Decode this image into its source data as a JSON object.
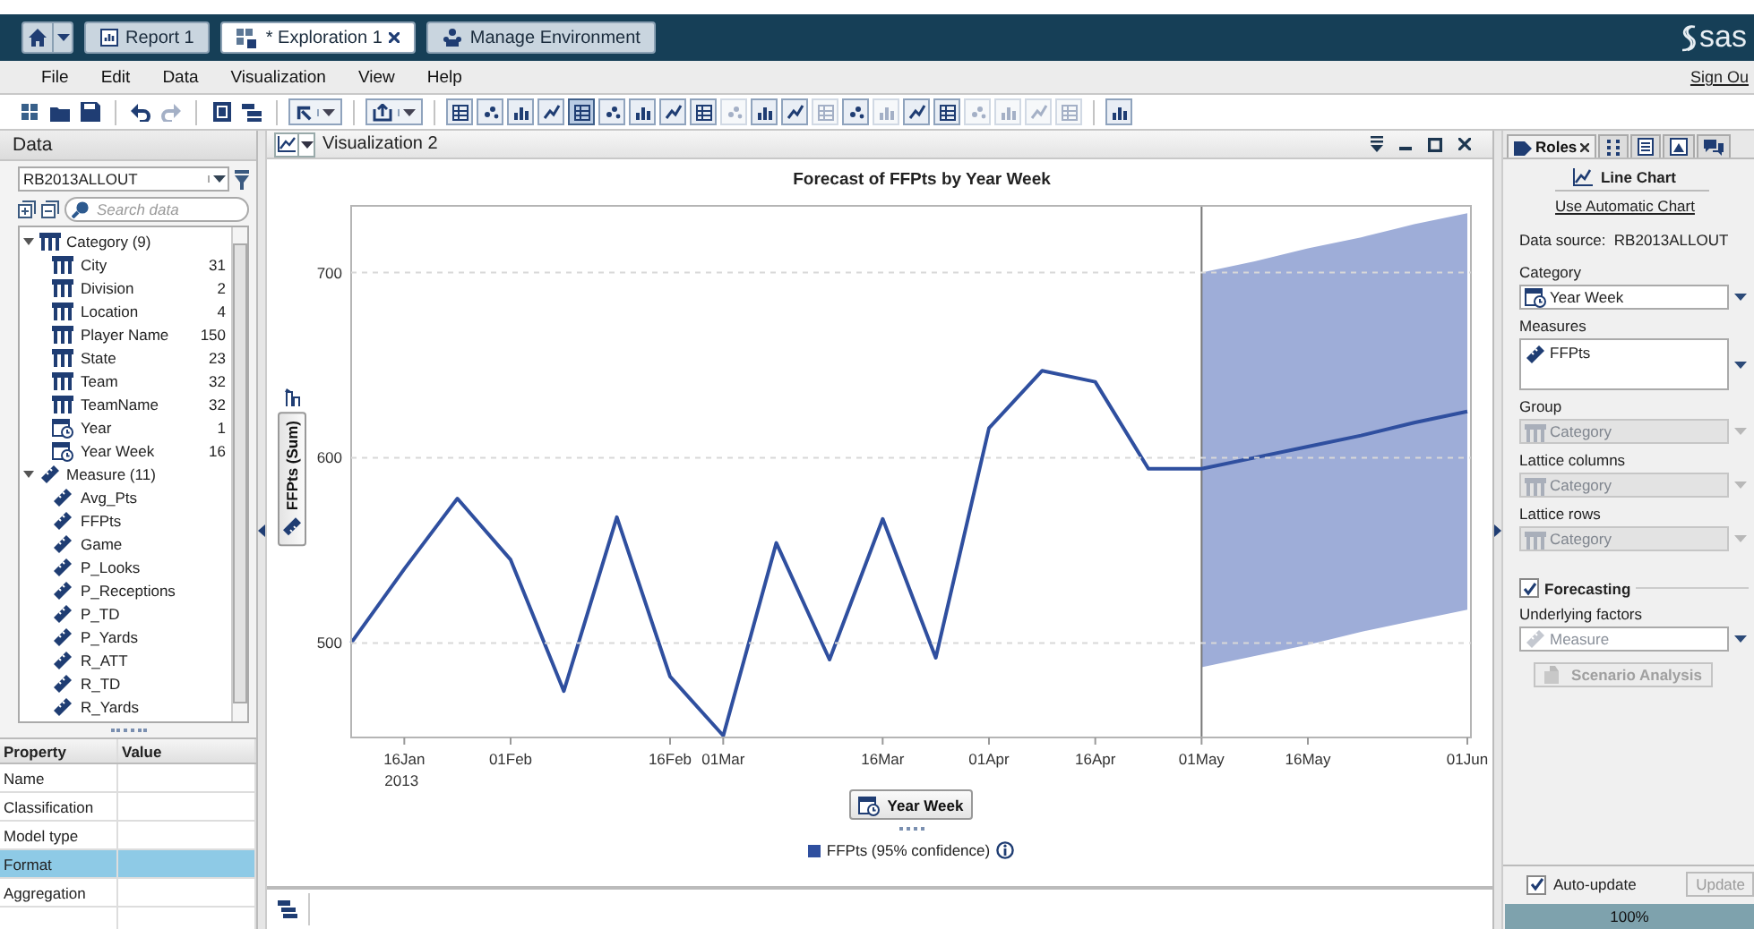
{
  "top_tabs": [
    {
      "label": "Report 1",
      "kind": "report",
      "selected": false,
      "closable": false
    },
    {
      "label": "* Exploration 1",
      "kind": "exploration",
      "selected": true,
      "closable": true
    },
    {
      "label": "Manage Environment",
      "kind": "manage",
      "selected": false,
      "closable": false
    }
  ],
  "logo": "sas",
  "menu": [
    "File",
    "Edit",
    "Data",
    "Visualization",
    "View",
    "Help"
  ],
  "sign_out": "Sign Ou",
  "toolbar": [
    {
      "kind": "new",
      "disabled": false
    },
    {
      "kind": "open",
      "disabled": false
    },
    {
      "kind": "save",
      "disabled": false
    },
    {
      "kind": "sep"
    },
    {
      "kind": "undo",
      "disabled": false
    },
    {
      "kind": "redo",
      "disabled": true
    },
    {
      "kind": "sep"
    },
    {
      "kind": "panel",
      "disabled": false
    },
    {
      "kind": "layers",
      "disabled": false
    },
    {
      "kind": "sep"
    },
    {
      "kind": "pointer-menu",
      "disabled": false
    },
    {
      "kind": "sep"
    },
    {
      "kind": "export-menu",
      "disabled": false
    },
    {
      "kind": "sep"
    },
    {
      "kind": "chart",
      "selected": false,
      "disabled": false
    },
    {
      "kind": "chart",
      "selected": false,
      "disabled": false
    },
    {
      "kind": "chart",
      "selected": false,
      "disabled": false
    },
    {
      "kind": "chart",
      "selected": false,
      "disabled": false
    },
    {
      "kind": "chart",
      "selected": true,
      "disabled": false
    },
    {
      "kind": "chart",
      "selected": false,
      "disabled": false
    },
    {
      "kind": "chart",
      "selected": false,
      "disabled": false
    },
    {
      "kind": "chart",
      "selected": false,
      "disabled": false
    },
    {
      "kind": "chart",
      "selected": false,
      "disabled": false
    },
    {
      "kind": "chart",
      "selected": false,
      "disabled": true
    },
    {
      "kind": "chart",
      "selected": false,
      "disabled": false
    },
    {
      "kind": "chart",
      "selected": false,
      "disabled": false
    },
    {
      "kind": "chart",
      "selected": false,
      "disabled": true
    },
    {
      "kind": "chart",
      "selected": false,
      "disabled": false
    },
    {
      "kind": "chart",
      "selected": false,
      "disabled": true
    },
    {
      "kind": "chart",
      "selected": false,
      "disabled": false
    },
    {
      "kind": "chart",
      "selected": false,
      "disabled": false
    },
    {
      "kind": "chart",
      "selected": false,
      "disabled": true
    },
    {
      "kind": "chart",
      "selected": false,
      "disabled": true
    },
    {
      "kind": "chart",
      "selected": false,
      "disabled": true
    },
    {
      "kind": "chart",
      "selected": false,
      "disabled": true
    },
    {
      "kind": "sep"
    },
    {
      "kind": "chart",
      "selected": false,
      "disabled": false
    }
  ],
  "data_panel": {
    "title": "Data",
    "source": "RB2013ALLOUT",
    "search_placeholder": "Search data",
    "groups": [
      {
        "label": "Category (9)",
        "kind": "category",
        "expanded": true,
        "children": [
          {
            "name": "City",
            "kind": "category",
            "count": "31"
          },
          {
            "name": "Division",
            "kind": "category",
            "count": "2"
          },
          {
            "name": "Location",
            "kind": "category",
            "count": "4"
          },
          {
            "name": "Player Name",
            "kind": "category",
            "count": "150"
          },
          {
            "name": "State",
            "kind": "category",
            "count": "23"
          },
          {
            "name": "Team",
            "kind": "category",
            "count": "32"
          },
          {
            "name": "TeamName",
            "kind": "category",
            "count": "32"
          },
          {
            "name": "Year",
            "kind": "date",
            "count": "1"
          },
          {
            "name": "Year Week",
            "kind": "date",
            "count": "16"
          }
        ]
      },
      {
        "label": "Measure (11)",
        "kind": "measure",
        "expanded": true,
        "children": [
          {
            "name": "Avg_Pts",
            "kind": "measure"
          },
          {
            "name": "FFPts",
            "kind": "measure"
          },
          {
            "name": "Game",
            "kind": "measure"
          },
          {
            "name": "P_Looks",
            "kind": "measure"
          },
          {
            "name": "P_Receptions",
            "kind": "measure"
          },
          {
            "name": "P_TD",
            "kind": "measure"
          },
          {
            "name": "P_Yards",
            "kind": "measure"
          },
          {
            "name": "R_ATT",
            "kind": "measure"
          },
          {
            "name": "R_TD",
            "kind": "measure"
          },
          {
            "name": "R_Yards",
            "kind": "measure"
          }
        ]
      }
    ]
  },
  "properties": {
    "columns": [
      "Property",
      "Value"
    ],
    "rows": [
      {
        "name": "Name",
        "selected": false
      },
      {
        "name": "Classification",
        "selected": false
      },
      {
        "name": "Model type",
        "selected": false
      },
      {
        "name": "Format",
        "selected": true
      },
      {
        "name": "Aggregation",
        "selected": false
      }
    ]
  },
  "visualization": {
    "title": "Visualization 2",
    "year_label": "2013",
    "chart_data": {
      "type": "line",
      "title": "Forecast of FFPts by Year Week",
      "xlabel": "Year Week",
      "ylabel": "FFPts (Sum)",
      "categories": [
        null,
        "16Jan",
        null,
        "01Feb",
        null,
        null,
        "16Feb",
        "01Mar",
        null,
        null,
        "16Mar",
        null,
        "01Apr",
        null,
        "16Apr",
        null,
        "01May",
        null,
        "16May",
        null,
        null,
        "01Jun"
      ],
      "ylim": [
        449,
        736
      ],
      "grid": true,
      "yticks": [
        500,
        600,
        700
      ],
      "series": [
        {
          "name": "FFPts (95% confidence)",
          "color": "#2f4f9f",
          "values": [
            500,
            540,
            578,
            545,
            474,
            568,
            482,
            450,
            554,
            491,
            567,
            492,
            616,
            647,
            641,
            594,
            594,
            600,
            606,
            612,
            619,
            625
          ]
        },
        {
          "type": "area",
          "color": "#9eadd8",
          "values": [
            null,
            null,
            null,
            null,
            null,
            null,
            null,
            null,
            null,
            null,
            null,
            null,
            null,
            null,
            null,
            null,
            700,
            706,
            713,
            719,
            726,
            732
          ]
        },
        {
          "type": "area",
          "color": "#ffffff",
          "values": [
            null,
            null,
            null,
            null,
            null,
            null,
            null,
            null,
            null,
            null,
            null,
            null,
            null,
            null,
            null,
            null,
            487,
            493,
            499,
            506,
            512,
            518
          ]
        }
      ]
    }
  },
  "roles_panel": {
    "tabs": [
      {
        "label": "Roles",
        "kind": "roles",
        "selected": true
      },
      {
        "kind": "filters",
        "selected": false
      },
      {
        "kind": "properties",
        "selected": false
      },
      {
        "kind": "styles",
        "selected": false
      },
      {
        "kind": "comments",
        "selected": false
      }
    ],
    "chart_type": "Line Chart",
    "auto_link": "Use Automatic Chart",
    "data_source": "Data source:  RB2013ALLOUT",
    "fields": [
      {
        "label": "Category",
        "value": "Year Week",
        "kind": "date",
        "disabled": false
      },
      {
        "label": "Measures",
        "value": "FFPts",
        "kind": "measure",
        "disabled": false
      },
      {
        "label": "Group",
        "placeholder": "Category",
        "kind": "category",
        "disabled": true
      },
      {
        "label": "Lattice columns",
        "placeholder": "Category",
        "kind": "category",
        "disabled": true
      },
      {
        "label": "Lattice rows",
        "placeholder": "Category",
        "kind": "category",
        "disabled": true
      }
    ],
    "forecasting": {
      "label": "Forecasting",
      "checked": true
    },
    "factors": {
      "label": "Underlying factors",
      "placeholder": "Measure"
    },
    "scenario_button": {
      "label": "Scenario Analysis",
      "disabled": true
    },
    "auto_update": {
      "label": "Auto-update",
      "checked": true
    },
    "update_button": {
      "label": "Update",
      "disabled": true
    },
    "progress": {
      "label": "100%",
      "level": 1
    }
  }
}
